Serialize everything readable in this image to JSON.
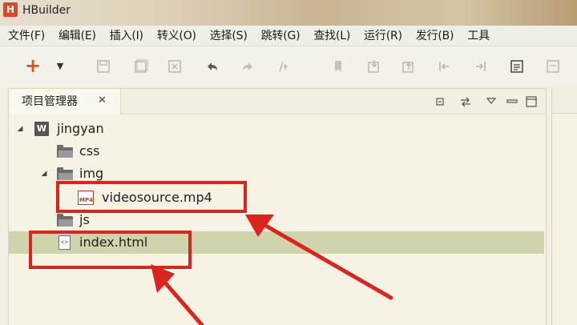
{
  "window": {
    "title": "HBuilder",
    "logo_letter": "H"
  },
  "menu": [
    "文件(F)",
    "编辑(E)",
    "插入(I)",
    "转义(O)",
    "选择(S)",
    "跳转(G)",
    "查找(L)",
    "运行(R)",
    "发行(B)",
    "工具"
  ],
  "toolbar": {
    "plus_icon": "+",
    "dropdown_icon": "▼",
    "icons": [
      "save-icon",
      "save-all-icon",
      "close-file-icon",
      "undo-icon",
      "redo-icon",
      "format-icon",
      "bookmark-icon",
      "import-icon",
      "export-icon",
      "jump-back-icon",
      "jump-forward-icon",
      "preview-icon",
      "browser-icon"
    ]
  },
  "panel": {
    "tab_label": "项目管理器",
    "close_glyph": "✕"
  },
  "tree": [
    {
      "label": "jingyan",
      "type": "project",
      "expanded": true
    },
    {
      "label": "css",
      "type": "folder"
    },
    {
      "label": "img",
      "type": "folder",
      "expanded": true
    },
    {
      "label": "videosource.mp4",
      "type": "mp4",
      "icon_text": "MP4"
    },
    {
      "label": "js",
      "type": "folder"
    },
    {
      "label": "index.html",
      "type": "html",
      "icon_text": "<>",
      "selected": true
    }
  ],
  "colors": {
    "highlight": "#d9251d",
    "selection": "#cfd4ad",
    "accent": "#d6561f"
  }
}
